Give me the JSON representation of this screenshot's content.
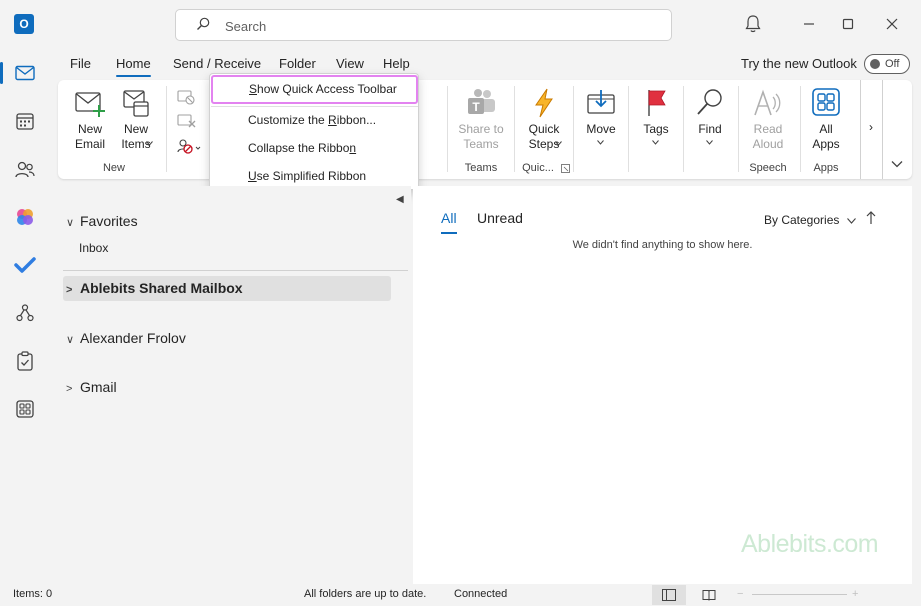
{
  "app": {
    "logo_letter": "O"
  },
  "search": {
    "placeholder": "Search"
  },
  "tabs": [
    "File",
    "Home",
    "Send / Receive",
    "Folder",
    "View",
    "Help"
  ],
  "try_new": {
    "label": "Try the new Outlook",
    "toggle": "Off"
  },
  "ribbon": {
    "new_email": "New Email",
    "new_items": "New Items",
    "group_new": "New",
    "share_to_teams": "Share to Teams",
    "group_teams": "Teams",
    "quick_steps": "Quick Steps",
    "group_quick": "Quic...",
    "move": "Move",
    "tags": "Tags",
    "find": "Find",
    "read_aloud": "Read Aloud",
    "group_speech": "Speech",
    "all_apps": "All Apps",
    "group_apps": "Apps",
    "more": "›"
  },
  "menu": {
    "items": [
      {
        "label": "Show Quick Access Toolbar",
        "underline": "S"
      },
      {
        "label": "Customize the Ribbon...",
        "underline": "R"
      },
      {
        "label": "Collapse the Ribbon",
        "underline": "n"
      },
      {
        "label": "Use Simplified Ribbon",
        "underline": "U"
      }
    ]
  },
  "folders": {
    "favorites": "Favorites",
    "inbox": "Inbox",
    "shared": "Ablebits Shared Mailbox",
    "alexander": "Alexander Frolov",
    "gmail": "Gmail"
  },
  "messages": {
    "tab_all": "All",
    "tab_unread": "Unread",
    "sort": "By Categories",
    "empty": "We didn't find anything to show here."
  },
  "watermark": {
    "brand": "Ablebits",
    "suffix": ".com"
  },
  "status": {
    "items": "Items: 0",
    "sync": "All folders are up to date.",
    "connection": "Connected",
    "zoom_minus": "−",
    "zoom_plus": "+"
  },
  "colors": {
    "accent": "#0f6cbd",
    "highlight": "#e383f0"
  }
}
